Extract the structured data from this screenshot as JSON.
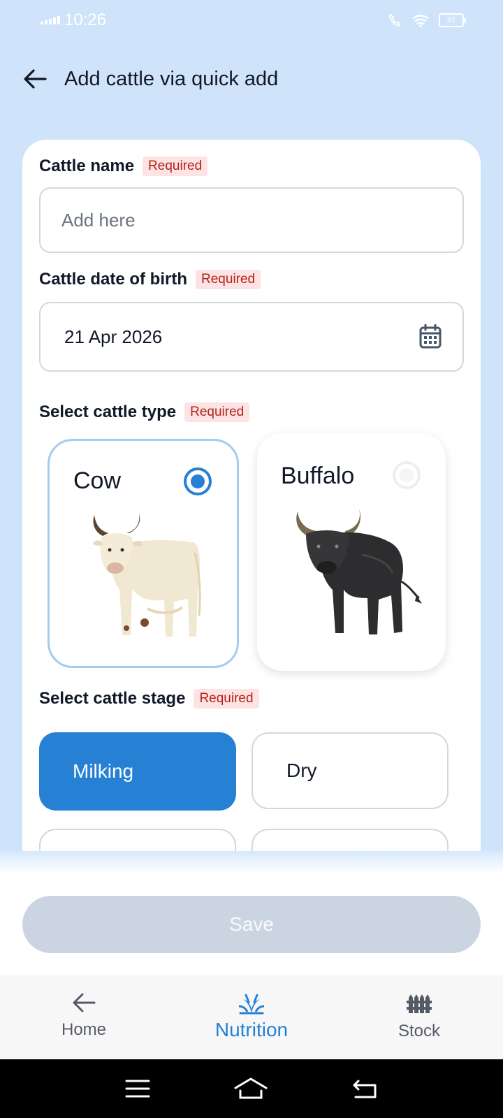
{
  "status_bar": {
    "time": "10:26",
    "battery": "92"
  },
  "header": {
    "title": "Add cattle via quick add"
  },
  "form": {
    "name": {
      "label": "Cattle name",
      "badge": "Required",
      "placeholder": "Add here"
    },
    "dob": {
      "label": "Cattle date of birth",
      "badge": "Required",
      "value": "21 Apr 2026"
    },
    "type": {
      "label": "Select cattle type",
      "badge": "Required",
      "options": [
        {
          "name": "Cow",
          "selected": true
        },
        {
          "name": "Buffalo",
          "selected": false
        }
      ]
    },
    "stage": {
      "label": "Select cattle stage",
      "badge": "Required",
      "options": [
        {
          "name": "Milking",
          "selected": true
        },
        {
          "name": "Dry",
          "selected": false
        }
      ]
    }
  },
  "save_label": "Save",
  "bottom_nav": [
    {
      "label": "Home",
      "icon": "arrow-left-icon"
    },
    {
      "label": "Nutrition",
      "icon": "sprout-icon",
      "active": true
    },
    {
      "label": "Stock",
      "icon": "fence-icon"
    }
  ],
  "colors": {
    "accent": "#2680d4",
    "background": "#cfe4fa",
    "badge_bg": "#fde3e3",
    "badge_text": "#b42318"
  }
}
